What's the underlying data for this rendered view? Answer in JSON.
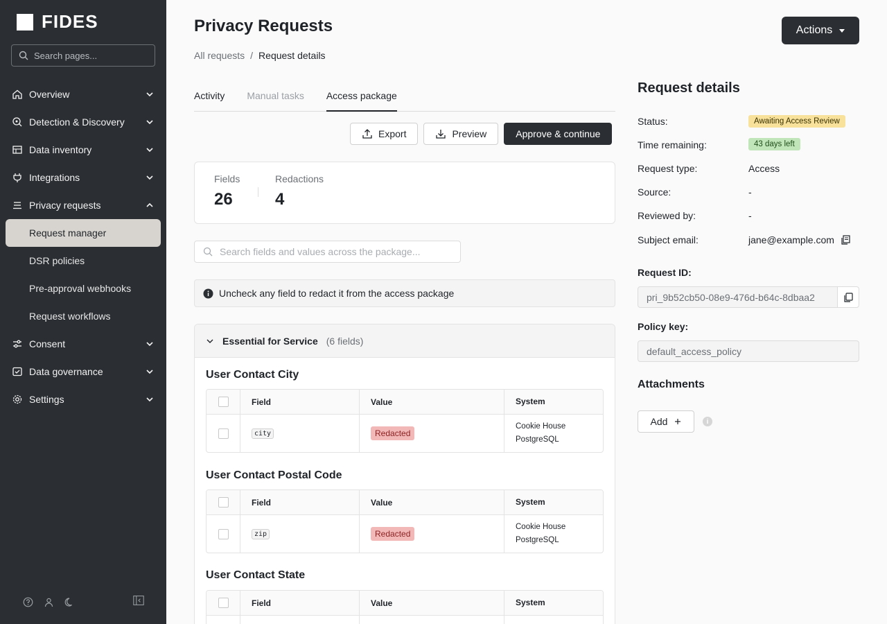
{
  "brand": {
    "name": "FIDES"
  },
  "sidebar": {
    "search_placeholder": "Search pages...",
    "items": [
      {
        "label": "Overview",
        "icon": "home-icon",
        "expanded": false
      },
      {
        "label": "Detection & Discovery",
        "icon": "radar-icon",
        "expanded": false
      },
      {
        "label": "Data inventory",
        "icon": "table-icon",
        "expanded": false
      },
      {
        "label": "Integrations",
        "icon": "plug-icon",
        "expanded": false
      },
      {
        "label": "Privacy requests",
        "icon": "list-icon",
        "expanded": true
      }
    ],
    "sub_items": [
      {
        "label": "Request manager",
        "active": true
      },
      {
        "label": "DSR policies"
      },
      {
        "label": "Pre-approval webhooks"
      },
      {
        "label": "Request workflows"
      }
    ],
    "items_after": [
      {
        "label": "Consent",
        "icon": "sliders-icon"
      },
      {
        "label": "Data governance",
        "icon": "shield-check-icon"
      },
      {
        "label": "Settings",
        "icon": "gear-icon"
      }
    ]
  },
  "header": {
    "title": "Privacy Requests",
    "breadcrumb": [
      "All requests",
      "/",
      "Request details"
    ],
    "actions_label": "Actions"
  },
  "tabs": [
    {
      "label": "Activity",
      "state": "normal"
    },
    {
      "label": "Manual tasks",
      "state": "disabled"
    },
    {
      "label": "Access package",
      "state": "active"
    }
  ],
  "toolbar": {
    "export_label": "Export",
    "preview_label": "Preview",
    "approve_label": "Approve & continue"
  },
  "stats": {
    "fields_label": "Fields",
    "fields_value": "26",
    "redactions_label": "Redactions",
    "redactions_value": "4"
  },
  "package": {
    "search_placeholder": "Search fields and values across the package...",
    "info_text": "Uncheck any field to redact it from the access package",
    "section_title": "Essential for Service",
    "section_count": "(6 fields)",
    "columns": [
      "Field",
      "Value",
      "System"
    ],
    "groups": [
      {
        "title": "User Contact City",
        "field": "city",
        "value": "Redacted",
        "system_line1": "Cookie House",
        "system_line2": "PostgreSQL"
      },
      {
        "title": "User Contact Postal Code",
        "field": "zip",
        "value": "Redacted",
        "system_line1": "Cookie House",
        "system_line2": "PostgreSQL"
      },
      {
        "title": "User Contact State"
      }
    ]
  },
  "details": {
    "title": "Request details",
    "status_label": "Status:",
    "status_value": "Awaiting Access Review",
    "time_label": "Time remaining:",
    "time_value": "43 days left",
    "type_label": "Request type:",
    "type_value": "Access",
    "source_label": "Source:",
    "source_value": "-",
    "reviewed_label": "Reviewed by:",
    "reviewed_value": "-",
    "email_label": "Subject email:",
    "email_value": "jane@example.com",
    "request_id_label": "Request ID:",
    "request_id_value": "pri_9b52cb50-08e9-476d-b64c-8dbaa2",
    "policy_key_label": "Policy key:",
    "policy_key_value": "default_access_policy",
    "attachments_title": "Attachments",
    "add_label": "Add"
  },
  "colors": {
    "sidebar_bg": "#2b2f33",
    "active_nav_bg": "#d7d4cf",
    "primary_button": "#2b2f33",
    "status_badge": "#f7e19b",
    "time_badge": "#bfe5b8",
    "redacted_badge": "#f2b8b8"
  }
}
